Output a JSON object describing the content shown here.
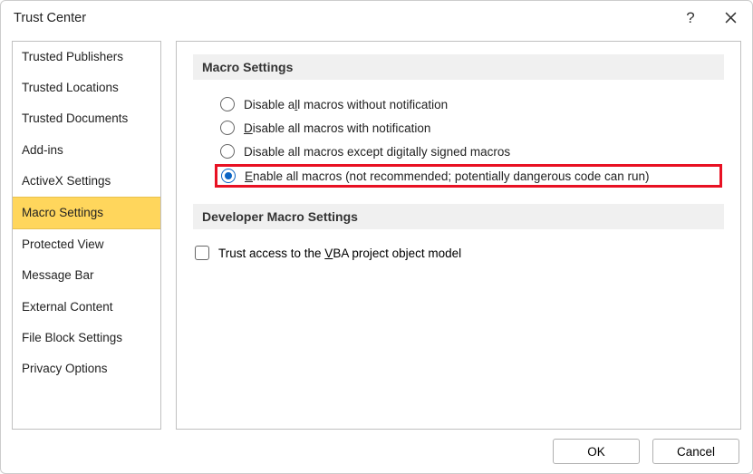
{
  "title": "Trust Center",
  "sidebar": {
    "items": [
      {
        "label": "Trusted Publishers"
      },
      {
        "label": "Trusted Locations"
      },
      {
        "label": "Trusted Documents"
      },
      {
        "label": "Add-ins"
      },
      {
        "label": "ActiveX Settings"
      },
      {
        "label": "Macro Settings"
      },
      {
        "label": "Protected View"
      },
      {
        "label": "Message Bar"
      },
      {
        "label": "External Content"
      },
      {
        "label": "File Block Settings"
      },
      {
        "label": "Privacy Options"
      }
    ],
    "selected_index": 5
  },
  "content": {
    "section1_title": "Macro Settings",
    "radios": [
      {
        "prefix": "Disable all macros without notification",
        "underline_index": 9
      },
      {
        "prefix": "Disable all macros with notification",
        "underline_index": -1,
        "raw": "Disable all macros with notification",
        "under_char_pos": 0
      },
      {
        "prefix": "Disable all macros except digitally signed macros",
        "underline_index": 27
      },
      {
        "prefix": "Enable all macros (not recommended; potentially dangerous code can run)",
        "underline_index": 0
      }
    ],
    "radio_labels_html": [
      "Disable a<span class='underline-char'>l</span>l macros without notification",
      "<span class='underline-char'>D</span>isable all macros with notification",
      "Disable all macros except di<span class='underline-char'>g</span>itally signed macros",
      "<span class='underline-char'>E</span>nable all macros (not recommended; potentially dangerous code can run)"
    ],
    "selected_radio": 3,
    "section2_title": "Developer Macro Settings",
    "checkbox_label_html": "Trust access to the <span class='underline-char'>V</span>BA project object model",
    "checkbox_checked": false
  },
  "footer": {
    "ok": "OK",
    "cancel": "Cancel"
  }
}
